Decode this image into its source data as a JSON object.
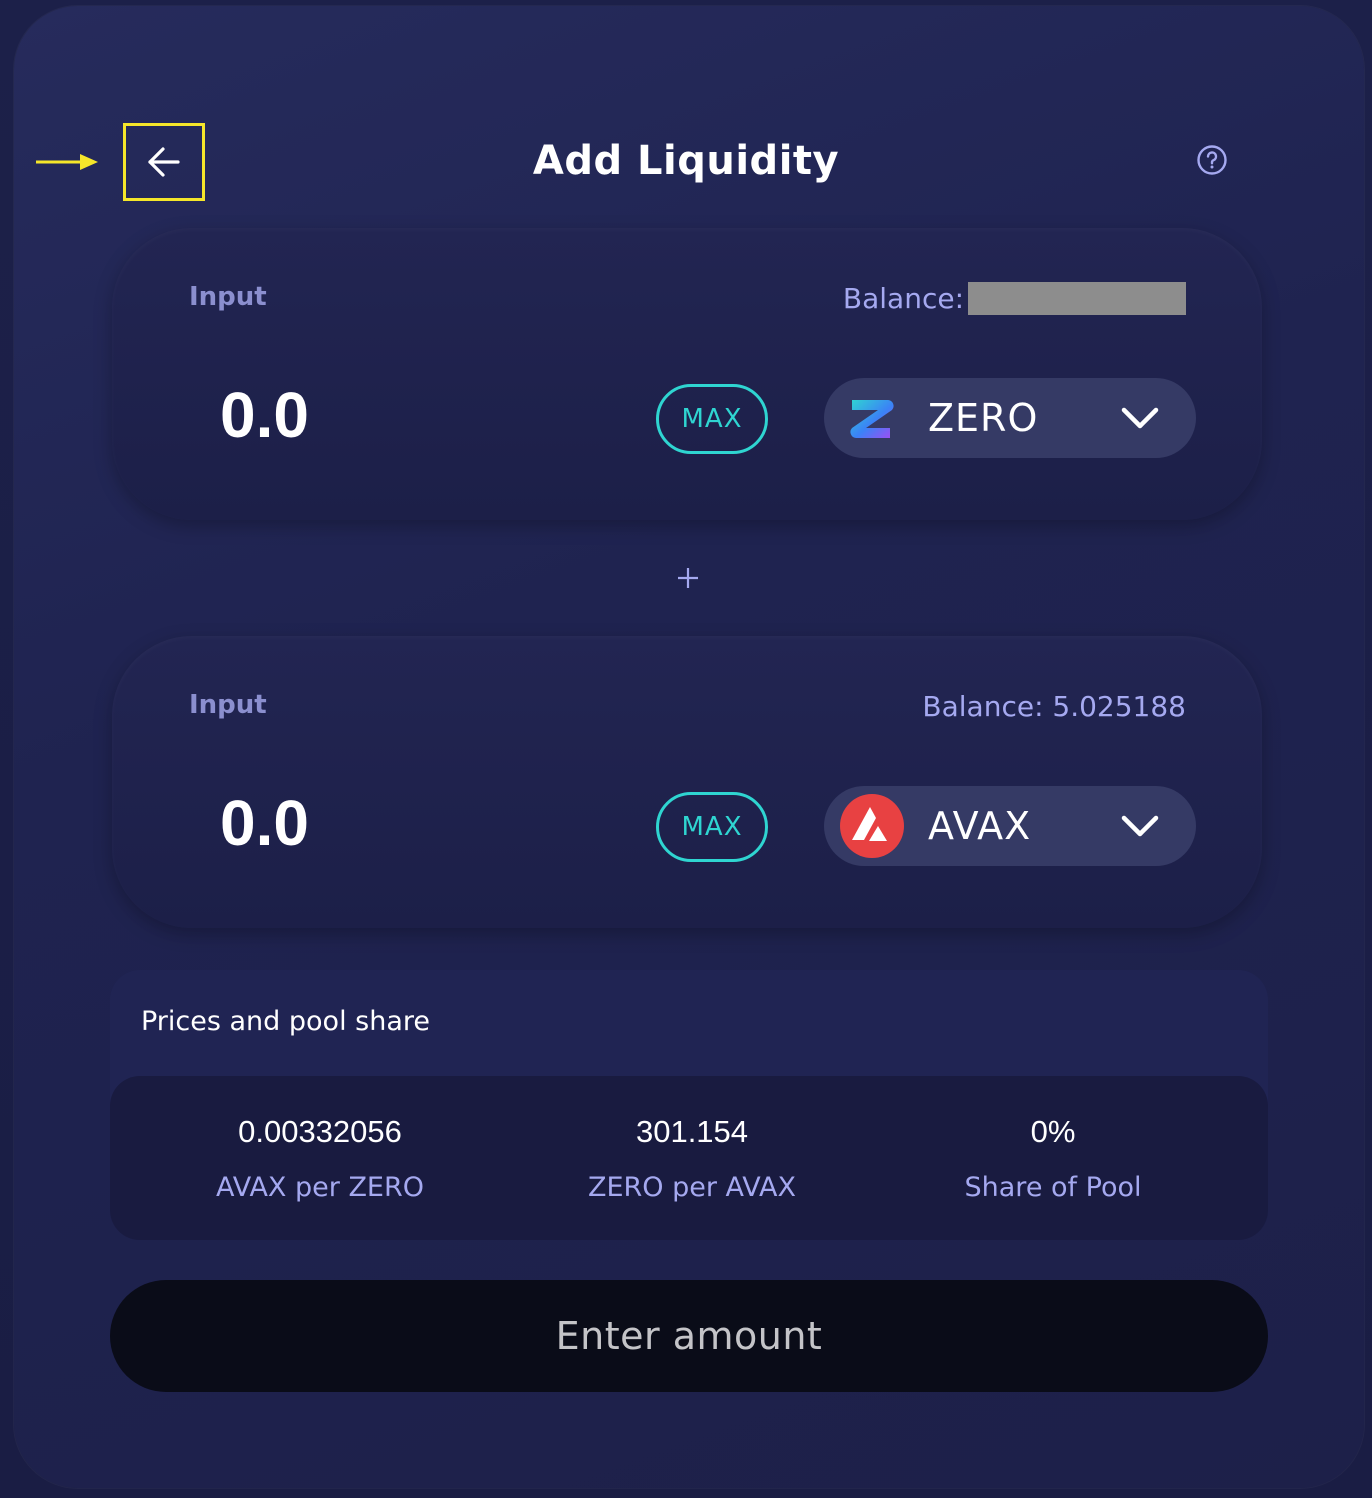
{
  "header": {
    "title": "Add Liquidity",
    "back_icon": "arrow-left-icon",
    "help_icon": "question-circle-icon"
  },
  "annotation": {
    "arrow_color": "#f5e62a"
  },
  "panel_a": {
    "label": "Input",
    "balance_label": "Balance:",
    "amount": "0.0",
    "max_label": "MAX",
    "token": "ZERO",
    "token_icon": "zero-token-icon"
  },
  "plus_icon": "plus-icon",
  "panel_b": {
    "label": "Input",
    "balance_label": "Balance: 5.025188",
    "amount": "0.0",
    "max_label": "MAX",
    "token": "AVAX",
    "token_icon": "avax-token-icon"
  },
  "prices": {
    "title": "Prices and pool share",
    "stats": [
      {
        "value": "0.00332056",
        "label": "AVAX per ZERO"
      },
      {
        "value": "301.154",
        "label": "ZERO per AVAX"
      },
      {
        "value": "0%",
        "label": "Share of Pool"
      }
    ]
  },
  "submit": {
    "label": "Enter amount"
  },
  "colors": {
    "accent_teal": "#2fd5d1",
    "label_purple": "#a5a9f0",
    "avax_red": "#e84142"
  }
}
